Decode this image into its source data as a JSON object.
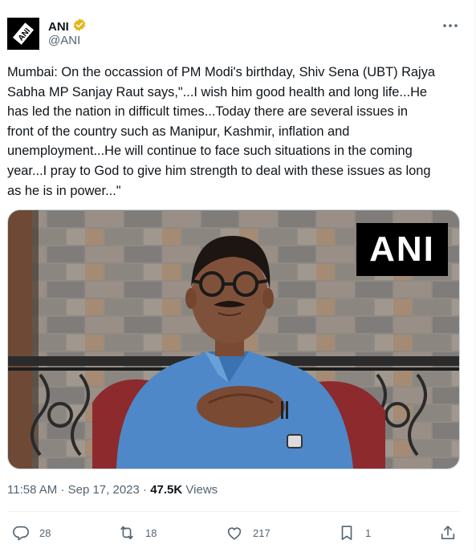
{
  "author": {
    "name": "ANI",
    "handle": "@ANI",
    "avatar_text": "ANI",
    "verified_color": "#e2b719"
  },
  "tweet": {
    "text": "Mumbai: On the occassion of PM Modi's birthday, Shiv Sena (UBT) Rajya\nSabha MP Sanjay Raut says,\"...I wish him good health and long life...He\nhas led the nation in difficult times...Today there are several issues in\nfront of the country such as Manipur, Kashmir, inflation and\nunemployment...He will continue to face such situations in the coming\nyear...I pray to God to give him strength to deal with these issues as long\nas he is in power...\"",
    "media_watermark": "ANI",
    "time": "11:58 AM",
    "separator": "·",
    "date": "Sep 17, 2023",
    "views_count": "47.5K",
    "views_label": "Views"
  },
  "actions": {
    "replies": "28",
    "reposts": "18",
    "likes": "217",
    "bookmarks": "1"
  },
  "icons": {
    "more": "more-icon",
    "verified": "verified-badge-icon",
    "reply": "reply-icon",
    "repost": "repost-icon",
    "like": "like-icon",
    "bookmark": "bookmark-icon",
    "share": "share-icon"
  },
  "colors": {
    "text": "#0f1419",
    "secondary": "#536471",
    "border": "#cfd9de"
  }
}
